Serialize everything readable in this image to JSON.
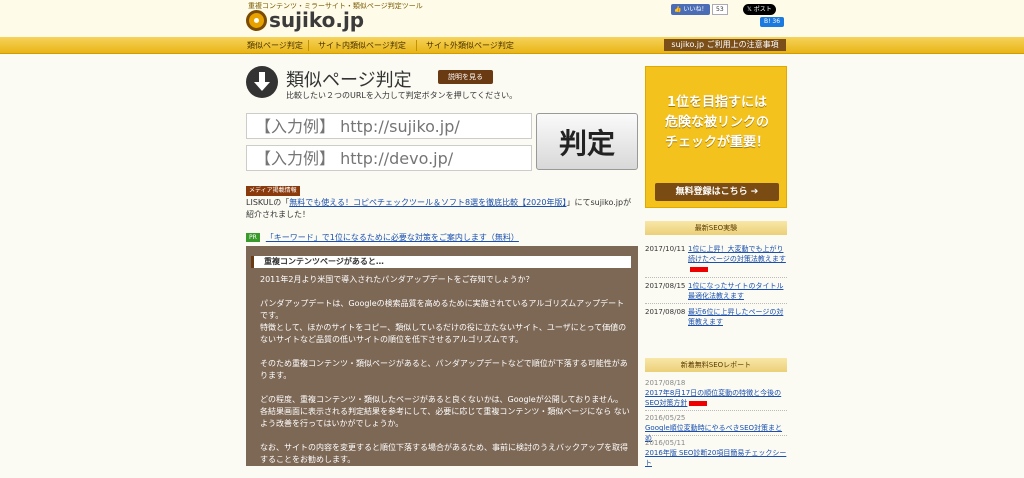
{
  "header": {
    "tagline": "重複コンテンツ・ミラーサイト・類似ページ判定ツール",
    "logo_text": "sujiko.jp",
    "like_label": "いいね！",
    "like_count": "53",
    "x_post_label": "ポスト",
    "hatena_label": "B! 36"
  },
  "nav": {
    "items": [
      "類似ページ判定",
      "サイト内類似ページ判定",
      "サイト外類似ページ判定"
    ],
    "notice": "sujiko.jp ご利用上の注意事項"
  },
  "main": {
    "title": "類似ページ判定",
    "explain_button": "説明を見る",
    "subtitle": "比較したい２つのURLを入力して判定ボタンを押してください。",
    "url1_placeholder": "【入力例】 http://sujiko.jp/",
    "url2_placeholder": "【入力例】 http://devo.jp/",
    "judge_button": "判定",
    "media_badge": "メディア掲載情報",
    "media_prefix": "LISKULの「",
    "media_link": "無料でも使える！コピペチェックツール＆ソフト8選を徹底比較【2020年版】",
    "media_suffix": "」にてsujiko.jpが紹介されました！",
    "pr_badge": "PR",
    "pr_link": "「キーワード」で1位になるために必要な対策をご案内します（無料）"
  },
  "duplicate": {
    "heading": "重複コンテンツページがあると…",
    "paragraphs": [
      "2011年2月より米国で導入されたパンダアップデートをご存知でしょうか？",
      "パンダアップデートは、Googleの検索品質を高めるために実施されているアルゴリズムアップデートです。\n特徴として、ほかのサイトをコピー、類似しているだけの役に立たないサイト、ユーザにとって価値のないサイトなど品質の低いサイトの順位を低下させるアルゴリズムです。",
      "そのため重複コンテンツ・類似ページがあると、パンダアップデートなどで順位が下落する可能性があります。",
      "どの程度、重複コンテンツ・類似したページがあると良くないかは、Googleが公開しておりません。\n各結果画面に表示される判定結果を参考にして、必要に応じて重複コンテンツ・類似ページになら ないよう改善を行ってはいかがでしょうか。",
      "なお、サイトの内容を変更すると順位下落する場合があるため、事前に検討のうえバックアップを取得することをお勧めします。"
    ]
  },
  "sidebar": {
    "ad_line1": "1位を目指すには",
    "ad_line2": "危険な被リンクの",
    "ad_line3": "チェックが重要！",
    "ad_button": "無料登録はこちら ➔",
    "seo_heading": "最新SEO実験",
    "seo_items": [
      {
        "date": "2017/10/11",
        "title": "1位に上昇！大変動でも上がり続けたページの対策法教えます"
      },
      {
        "date": "2017/08/15",
        "title": "1位になったサイトのタイトル最適化法教えます"
      },
      {
        "date": "2017/08/08",
        "title": "最近6位に上昇したページの対策教えます"
      }
    ],
    "report_heading": "新着無料SEOレポート",
    "reports": [
      {
        "date": "2017/08/18",
        "title": "2017年8月17日の順位変動の特徴と今後のSEO対策方針"
      },
      {
        "date": "2016/05/25",
        "title": "Google順位変動時にやるべきSEO対策まとめ"
      },
      {
        "date": "2016/05/11",
        "title": "2016年版 SEO診断20項目簡易チェックシート"
      }
    ]
  }
}
